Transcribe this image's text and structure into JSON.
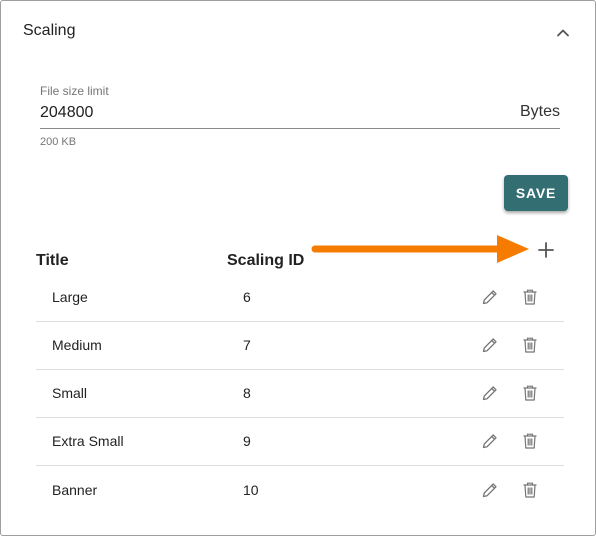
{
  "panel": {
    "title": "Scaling"
  },
  "file_size": {
    "label": "File size limit",
    "value": "204800",
    "suffix": "Bytes",
    "helper": "200 KB"
  },
  "actions": {
    "save_label": "SAVE"
  },
  "table": {
    "columns": [
      "Title",
      "Scaling ID"
    ],
    "rows": [
      {
        "title": "Large",
        "id": "6"
      },
      {
        "title": "Medium",
        "id": "7"
      },
      {
        "title": "Small",
        "id": "8"
      },
      {
        "title": "Extra Small",
        "id": "9"
      },
      {
        "title": "Banner",
        "id": "10"
      }
    ]
  },
  "icons": {
    "collapse": "chevron-up-icon",
    "add": "plus-icon",
    "edit": "pencil-icon",
    "delete": "trash-icon",
    "annotation": "arrow-right-icon"
  },
  "colors": {
    "accent": "#336e72",
    "annotation_arrow": "#f57c00",
    "icon_gray": "#757575"
  }
}
